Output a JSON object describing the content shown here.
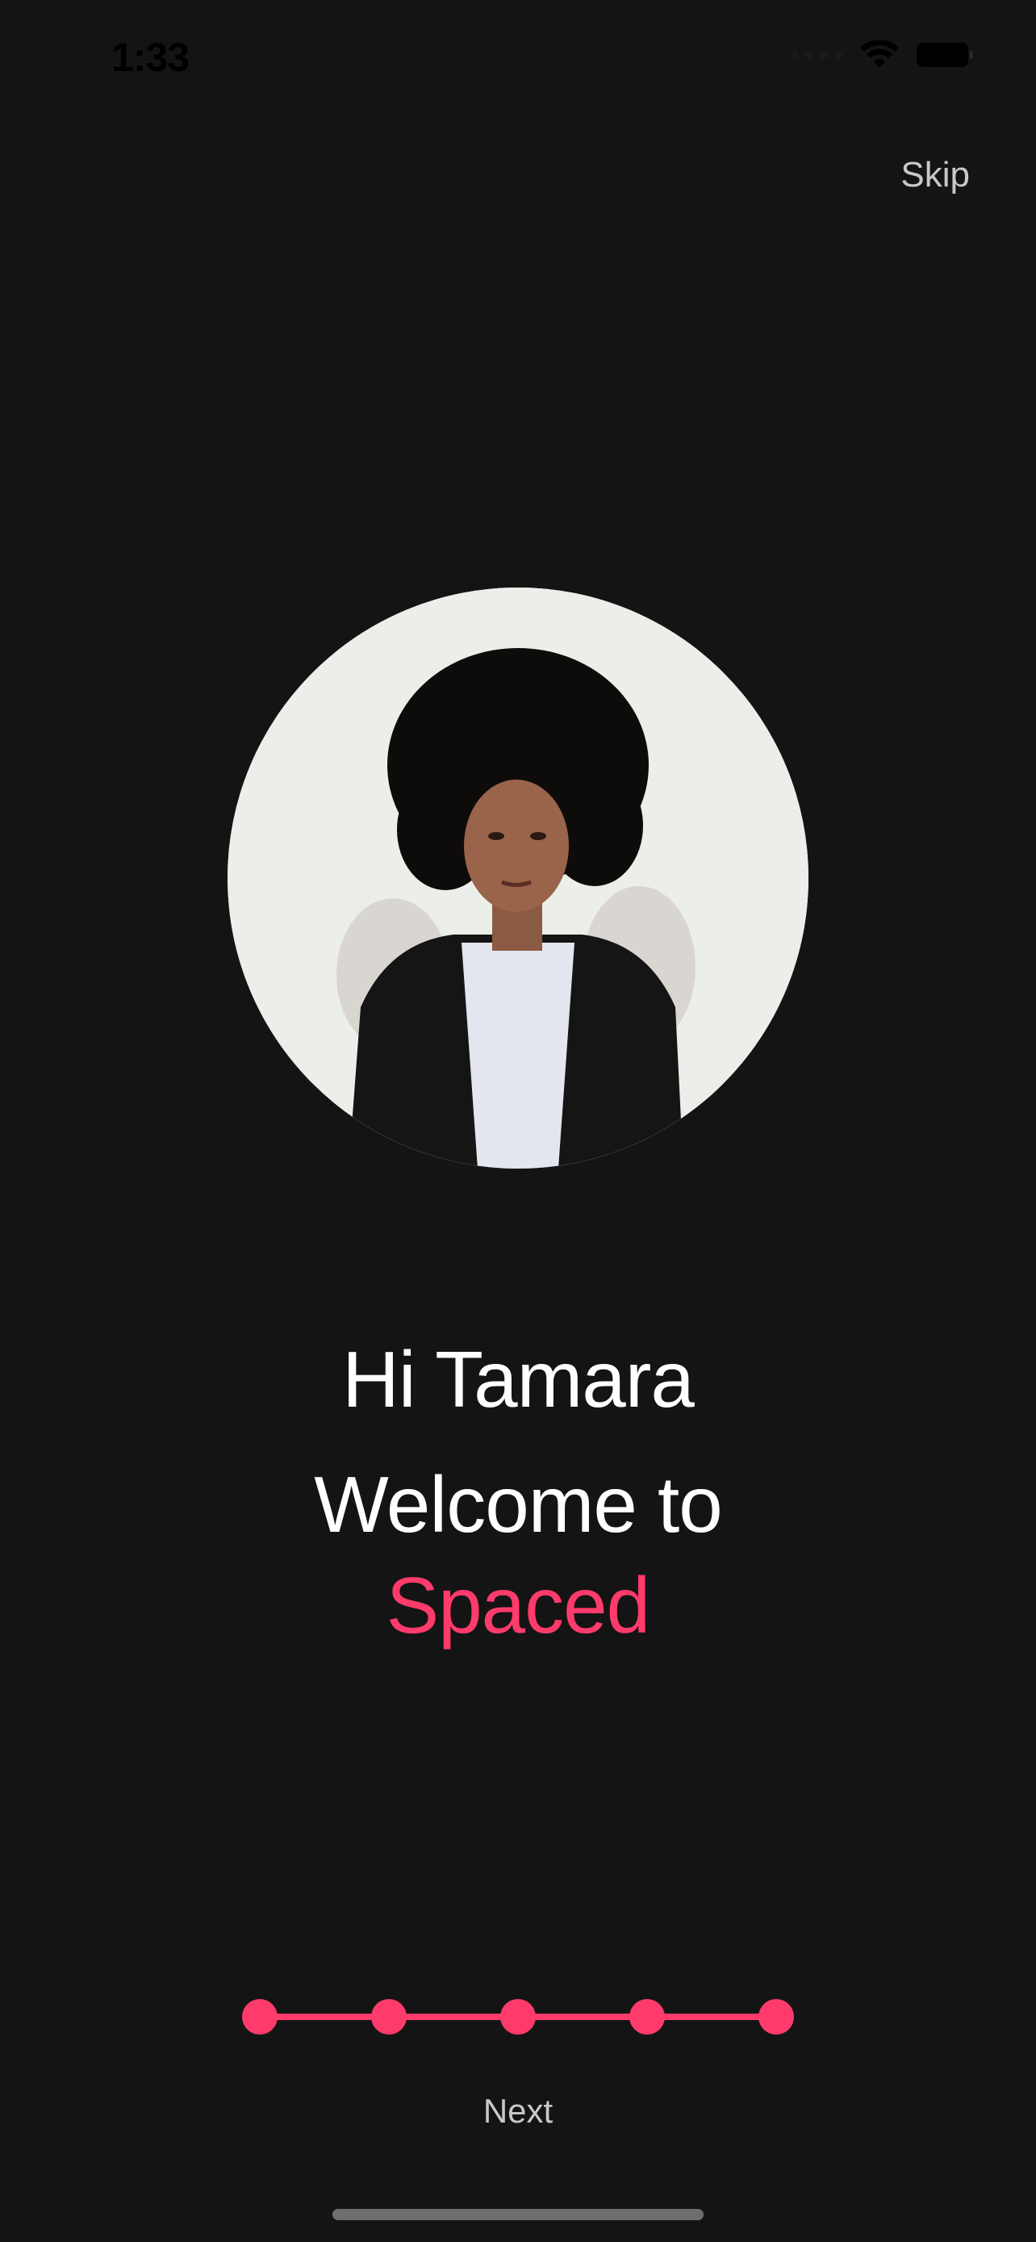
{
  "status_bar": {
    "time": "1:33",
    "icons": [
      "signal-icon",
      "wifi-icon",
      "battery-icon"
    ]
  },
  "header": {
    "skip_label": "Skip"
  },
  "avatar": {
    "description": "profile-photo"
  },
  "greeting": {
    "line1": "Hi Tamara",
    "line2": "Welcome to",
    "app_name": "Spaced"
  },
  "onboarding": {
    "step_count": 5,
    "next_label": "Next"
  },
  "colors": {
    "background": "#141414",
    "accent": "#ff3b6b",
    "muted_text": "#c8c8c8",
    "primary_text": "#ffffff"
  }
}
